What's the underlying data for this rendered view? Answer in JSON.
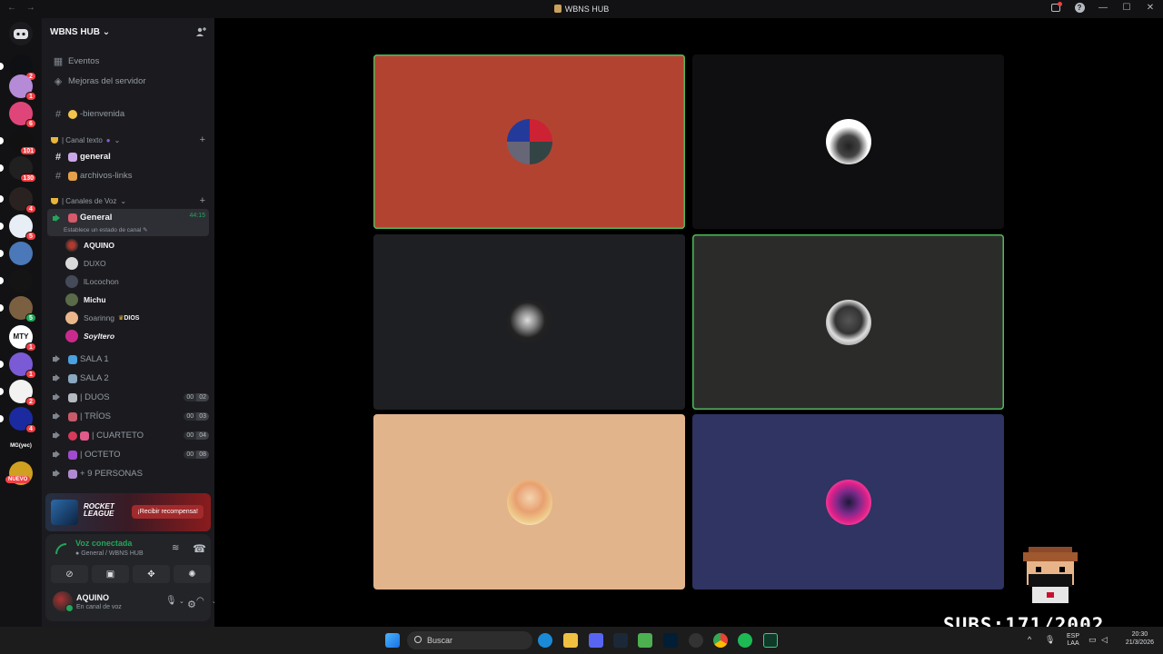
{
  "window": {
    "title": "WBNS HUB",
    "nav": "← →"
  },
  "server": {
    "name": "WBNS HUB ⌄"
  },
  "sidebar": {
    "events": "Eventos",
    "boosts": "Mejoras del servidor",
    "welcome": "-bienvenida",
    "cat_text": "| Canal texto",
    "general_text": "general",
    "files": "archivos-links",
    "cat_voice": "| Canales de Voz",
    "voice_general": "General",
    "voice_timer": "44:15",
    "voice_status": "Establece un estado de canal",
    "members": [
      {
        "name": "AQUINO",
        "bold": true,
        "color": "#b13a2f"
      },
      {
        "name": "DUXO",
        "bold": false,
        "color": "#d9d9d9"
      },
      {
        "name": "lLocochon",
        "bold": false,
        "color": "#444a57"
      },
      {
        "name": "Michu",
        "bold": true,
        "color": "#5a6b4a"
      },
      {
        "name": "Soarinng",
        "bold": false,
        "color": "#e9b78a",
        "tag": "DIOS"
      },
      {
        "name": "Soyltero",
        "bold": true,
        "color": "#c92a8c"
      }
    ],
    "rooms": [
      {
        "name": "SALA 1"
      },
      {
        "name": "SALA 2"
      },
      {
        "name": "| DUOS",
        "cap_a": "00",
        "cap_b": "02"
      },
      {
        "name": "| TRÍOS",
        "cap_a": "00",
        "cap_b": "03"
      },
      {
        "name": "| CUARTETO",
        "cap_a": "00",
        "cap_b": "04"
      },
      {
        "name": "| OCTETO",
        "cap_a": "00",
        "cap_b": "08"
      },
      {
        "name": "+ 9 PERSONAS"
      }
    ]
  },
  "servers_rail": {
    "badges": [
      "2",
      "1",
      "6",
      "101",
      "130",
      "4",
      "5",
      "5",
      "1",
      "1",
      "5",
      "2",
      "4"
    ],
    "texts": {
      "mty": "MTY",
      "mg": "MG(yec)"
    },
    "nuevo": "NUEVO"
  },
  "promo": {
    "logo_line1": "ROCKET",
    "logo_line2": "LEAGUE",
    "cta": "¡Recibir recompensa!"
  },
  "voice_panel": {
    "title": "Voz conectada",
    "subtitle": "General / WBNS HUB",
    "user_name": "AQUINO",
    "user_status": "En canal de voz"
  },
  "colors": {
    "accent_green": "#23a55a",
    "tile_1": "#b34331",
    "tile_2": "#0f0f12",
    "tile_3": "#1e1f22",
    "tile_4": "#2b2c2a",
    "tile_5": "#e2b48c",
    "tile_6": "#2f3462"
  },
  "taskbar": {
    "search": "Buscar",
    "lang_1": "ESP",
    "lang_2": "LAA",
    "time": "20:30",
    "date": "21/3/2026"
  },
  "overlay": {
    "subs": "SUBS:171/2002"
  }
}
